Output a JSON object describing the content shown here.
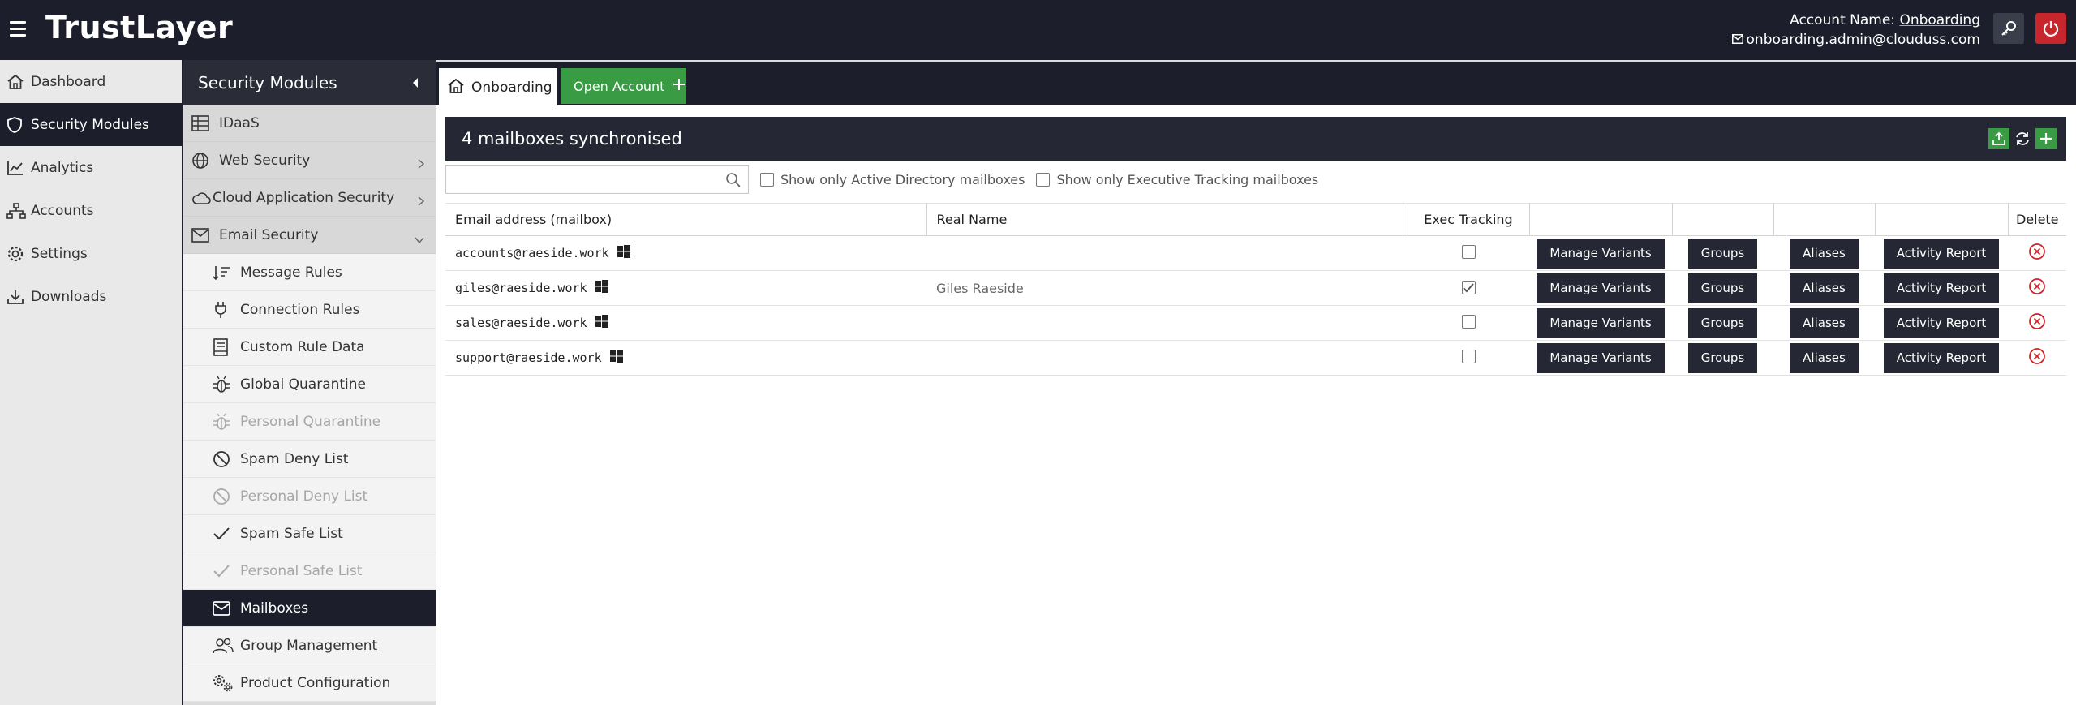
{
  "brand": {
    "logo_text": "TrustLayer"
  },
  "account": {
    "name_label": "Account Name:",
    "name_value": "Onboarding",
    "email": "onboarding.admin@clouduss.com"
  },
  "colors": {
    "topbar": "#1c1f2b",
    "accent_green": "#3a9b45",
    "danger_red": "#c7262c",
    "dark_button": "#252834"
  },
  "leftnav": {
    "items": [
      {
        "label": "Dashboard",
        "icon": "home-icon"
      },
      {
        "label": "Security Modules",
        "icon": "shield-icon",
        "active": true
      },
      {
        "label": "Analytics",
        "icon": "chart-icon"
      },
      {
        "label": "Accounts",
        "icon": "network-icon"
      },
      {
        "label": "Settings",
        "icon": "gear-icon"
      },
      {
        "label": "Downloads",
        "icon": "download-icon"
      }
    ]
  },
  "modules": {
    "title": "Security Modules",
    "items": [
      "IDaaS",
      "Web Security",
      "Cloud Application Security",
      "Email Security"
    ],
    "sub_items": [
      {
        "label": "Message Rules",
        "icon": "sort-icon"
      },
      {
        "label": "Connection Rules",
        "icon": "plug-icon"
      },
      {
        "label": "Custom Rule Data",
        "icon": "book-icon"
      },
      {
        "label": "Global Quarantine",
        "icon": "bug-icon"
      },
      {
        "label": "Personal Quarantine",
        "icon": "bug-icon",
        "disabled": true
      },
      {
        "label": "Spam Deny List",
        "icon": "ban-icon"
      },
      {
        "label": "Personal Deny List",
        "icon": "ban-icon",
        "disabled": true
      },
      {
        "label": "Spam Safe List",
        "icon": "check-icon"
      },
      {
        "label": "Personal Safe List",
        "icon": "check-icon",
        "disabled": true
      },
      {
        "label": "Mailboxes",
        "icon": "envelope-icon",
        "active": true
      },
      {
        "label": "Group Management",
        "icon": "users-icon"
      },
      {
        "label": "Product Configuration",
        "icon": "cogs-icon"
      }
    ]
  },
  "tabs": {
    "home_label": "Onboarding",
    "open_label": "Open Account"
  },
  "content": {
    "title": "4 mailboxes synchronised",
    "search_placeholder": "",
    "filter_ad": "Show only Active Directory mailboxes",
    "filter_exec": "Show only Executive Tracking mailboxes"
  },
  "table": {
    "headers": {
      "email": "Email address (mailbox)",
      "realname": "Real Name",
      "exec": "Exec Tracking",
      "delete": "Delete"
    },
    "buttons": {
      "variants": "Manage Variants",
      "groups": "Groups",
      "aliases": "Aliases",
      "report": "Activity Report"
    },
    "rows": [
      {
        "email": "accounts@raeside.work",
        "realname": "",
        "exec": false
      },
      {
        "email": "giles@raeside.work",
        "realname": "Giles Raeside",
        "exec": true
      },
      {
        "email": "sales@raeside.work",
        "realname": "",
        "exec": false
      },
      {
        "email": "support@raeside.work",
        "realname": "",
        "exec": false
      }
    ]
  }
}
